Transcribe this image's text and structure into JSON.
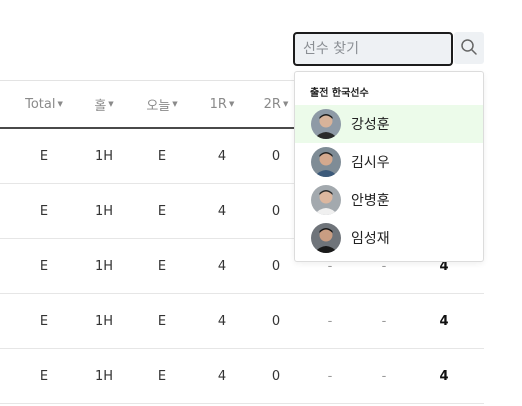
{
  "search": {
    "placeholder": "선수 찾기",
    "value": ""
  },
  "table": {
    "headers": [
      {
        "label": "Total",
        "caret": "▼"
      },
      {
        "label": "홀",
        "caret": "▼"
      },
      {
        "label": "오늘",
        "caret": "▼"
      },
      {
        "label": "1R",
        "caret": "▼"
      },
      {
        "label": "2R",
        "caret": "▼"
      }
    ],
    "rows": [
      {
        "total": "E",
        "hole": "1H",
        "today": "E",
        "r1": "4",
        "r2": "0",
        "r3": "",
        "r4": "",
        "tot": ""
      },
      {
        "total": "E",
        "hole": "1H",
        "today": "E",
        "r1": "4",
        "r2": "0",
        "r3": "",
        "r4": "",
        "tot": ""
      },
      {
        "total": "E",
        "hole": "1H",
        "today": "E",
        "r1": "4",
        "r2": "0",
        "r3": "-",
        "r4": "-",
        "tot": "4"
      },
      {
        "total": "E",
        "hole": "1H",
        "today": "E",
        "r1": "4",
        "r2": "0",
        "r3": "-",
        "r4": "-",
        "tot": "4"
      },
      {
        "total": "E",
        "hole": "1H",
        "today": "E",
        "r1": "4",
        "r2": "0",
        "r3": "-",
        "r4": "-",
        "tot": "4"
      }
    ]
  },
  "dropdown": {
    "title": "출전 한국선수",
    "players": [
      {
        "name": "강성훈",
        "active": true
      },
      {
        "name": "김시우",
        "active": false
      },
      {
        "name": "안병훈",
        "active": false
      },
      {
        "name": "임성재",
        "active": false
      }
    ]
  },
  "colors": {
    "highlight": "#ecfbea",
    "search_bg": "#eef1f4",
    "border_dark": "#1c1c1c"
  }
}
